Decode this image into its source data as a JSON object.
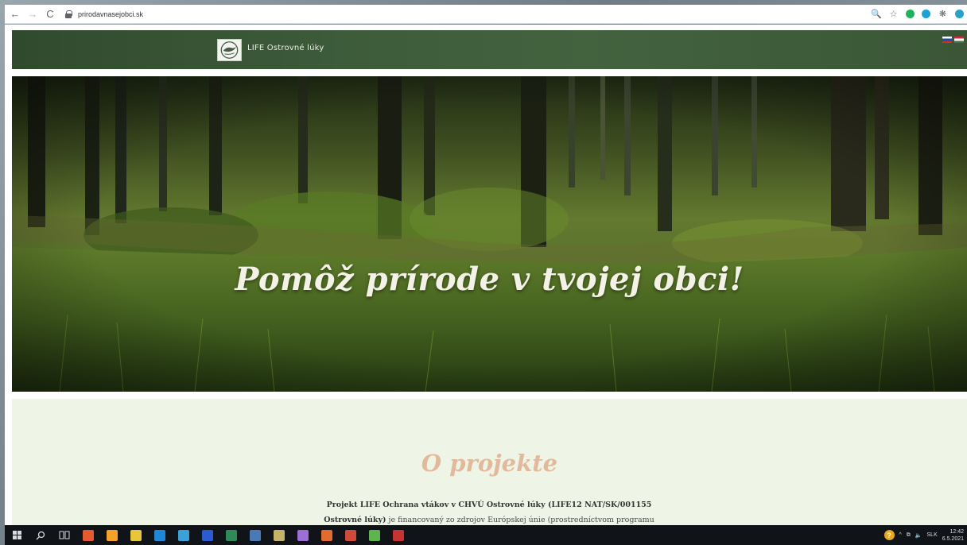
{
  "browser": {
    "url": "prirodavnasejobci.sk",
    "back_icon": "←",
    "forward_icon": "→",
    "reload_icon": "C",
    "zoom_icon": "🔍",
    "star_icon": "☆",
    "puzzle_icon": "❋"
  },
  "header": {
    "site_title": "LIFE Ostrovné lúky"
  },
  "hero": {
    "heading": "Pomôž prírode v tvojej obci!"
  },
  "about": {
    "title": "O projekte",
    "line1_bold": "Projekt LIFE Ochrana vtákov v CHVÚ Ostrovné lúky (LIFE12 NAT/SK/001155",
    "line2_bold": "Ostrovné lúky)",
    "line2_rest": " je financovaný zo zdrojov Európskej únie (prostredníctvom programu"
  },
  "taskbar": {
    "language": "SLK",
    "time": "12:42",
    "date": "6.5.2021",
    "help_icon": "?",
    "chevron_icon": "^",
    "sound_icon": "🔈",
    "tray_icon": "⧉",
    "app_colors": [
      "#e35b2e",
      "#f6a229",
      "#e8c63a",
      "#1e88d6",
      "#3aa2d9",
      "#2b5bd1",
      "#2e8b57",
      "#4a7ab5",
      "#c5b36a",
      "#9c6fd6",
      "#e26b2d",
      "#d04a3c",
      "#5fb44f",
      "#c83232"
    ]
  },
  "colors": {
    "header_bg": "#3d5c3a",
    "about_bg": "#eef4e6",
    "about_title": "#e2b99a"
  }
}
